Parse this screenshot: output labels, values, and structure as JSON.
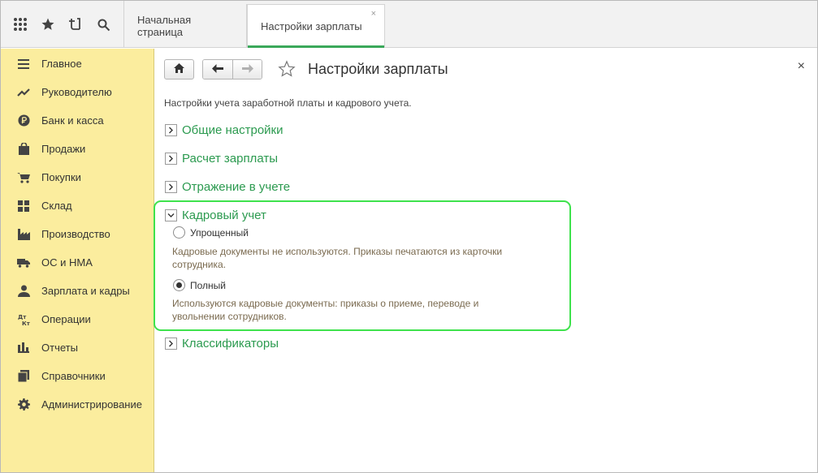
{
  "topbar": {
    "tools": [
      {
        "name": "apps-grid-icon"
      },
      {
        "name": "star-icon"
      },
      {
        "name": "history-icon"
      },
      {
        "name": "search-icon"
      }
    ],
    "tabs": [
      {
        "label": "Начальная страница",
        "active": false
      },
      {
        "label": "Настройки зарплаты",
        "active": true,
        "close": "×"
      }
    ]
  },
  "sidebar": {
    "items": [
      {
        "label": "Главное",
        "icon": "menu-lines-icon"
      },
      {
        "label": "Руководителю",
        "icon": "trend-up-icon"
      },
      {
        "label": "Банк и касса",
        "icon": "ruble-coin-icon"
      },
      {
        "label": "Продажи",
        "icon": "shopping-bag-icon"
      },
      {
        "label": "Покупки",
        "icon": "cart-icon"
      },
      {
        "label": "Склад",
        "icon": "warehouse-grid-icon"
      },
      {
        "label": "Производство",
        "icon": "factory-icon"
      },
      {
        "label": "ОС и НМА",
        "icon": "truck-icon"
      },
      {
        "label": "Зарплата и кадры",
        "icon": "people-icon"
      },
      {
        "label": "Операции",
        "icon": "debit-credit-icon"
      },
      {
        "label": "Отчеты",
        "icon": "bar-chart-icon"
      },
      {
        "label": "Справочники",
        "icon": "books-icon"
      },
      {
        "label": "Администрирование",
        "icon": "gear-icon"
      }
    ]
  },
  "main": {
    "title": "Настройки зарплаты",
    "close": "×",
    "description": "Настройки учета заработной платы и кадрового учета.",
    "sections": {
      "general": "Общие настройки",
      "payroll": "Расчет зарплаты",
      "accounting": "Отражение в учете",
      "hr": "Кадровый учет",
      "classifiers": "Классификаторы"
    },
    "hr_options": {
      "simple": {
        "label": "Упрощенный",
        "hint": "Кадровые документы не используются. Приказы печатаются из карточки сотрудника.",
        "selected": false
      },
      "full": {
        "label": "Полный",
        "hint": "Используются кадровые документы: приказы о приеме, переводе и увольнении сотрудников.",
        "selected": true
      }
    }
  },
  "colors": {
    "sidebar_bg": "#fbed9e",
    "section_link": "#2b9a4f",
    "highlight": "#3ee24c",
    "active_tab_underline": "#3aa85a",
    "hint_text": "#7a6a4f"
  }
}
